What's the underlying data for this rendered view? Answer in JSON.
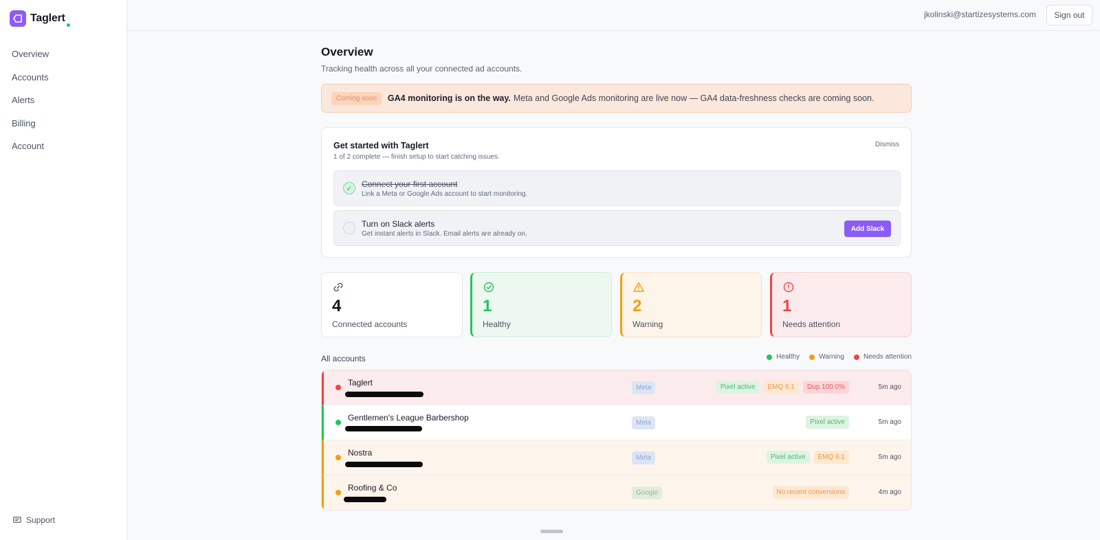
{
  "app": {
    "name": "Taglert"
  },
  "sidebar": {
    "items": [
      {
        "label": "Overview"
      },
      {
        "label": "Accounts"
      },
      {
        "label": "Alerts"
      },
      {
        "label": "Billing"
      },
      {
        "label": "Account"
      }
    ],
    "support_label": "Support"
  },
  "header": {
    "user_email": "jkolinski@startizesystems.com",
    "signout_label": "Sign out"
  },
  "page": {
    "title": "Overview",
    "subtitle": "Tracking health across all your connected ad accounts."
  },
  "banner": {
    "pill": "Coming soon",
    "strong": "GA4 monitoring is on the way.",
    "text": "Meta and Google Ads monitoring are live now — GA4 data-freshness checks are coming soon."
  },
  "setup": {
    "title": "Get started with Taglert",
    "subtitle": "1 of 2 complete — finish setup to start catching issues.",
    "dismiss_label": "Dismiss",
    "steps": [
      {
        "title": "Connect your first account",
        "desc": "Link a Meta or Google Ads account to start monitoring.",
        "done": true
      },
      {
        "title": "Turn on Slack alerts",
        "desc": "Get instant alerts in Slack. Email alerts are already on.",
        "done": false,
        "action": "Add Slack"
      }
    ]
  },
  "stats": [
    {
      "value": "4",
      "label": "Connected accounts",
      "icon": "link-icon",
      "color": "#131722"
    },
    {
      "value": "1",
      "label": "Healthy",
      "icon": "check-circle-icon",
      "color": "#22c55e"
    },
    {
      "value": "2",
      "label": "Warning",
      "icon": "warning-triangle-icon",
      "color": "#f59e0b"
    },
    {
      "value": "1",
      "label": "Needs attention",
      "icon": "alert-circle-icon",
      "color": "#ef4444"
    }
  ],
  "accounts": {
    "title": "All accounts",
    "legend": [
      "Healthy",
      "Warning",
      "Needs attention"
    ],
    "rows": [
      {
        "name": "Taglert",
        "status": "needs-attention",
        "platform": "Meta",
        "chips": [
          "Pixel active",
          "EMQ 6.1",
          "Dup 100.0%"
        ],
        "ago": "5m ago"
      },
      {
        "name": "Gentlemen's League Barbershop",
        "status": "healthy",
        "platform": "Meta",
        "chips": [
          "Pixel active"
        ],
        "ago": "5m ago"
      },
      {
        "name": "Nostra",
        "status": "warning",
        "platform": "Meta",
        "chips": [
          "Pixel active",
          "EMQ 6.1"
        ],
        "ago": "5m ago"
      },
      {
        "name": "Roofing & Co",
        "status": "warning",
        "platform": "Google",
        "chips": [
          "No recent conversions"
        ],
        "ago": "4m ago"
      }
    ]
  },
  "colors": {
    "accent": "#8b5cf6",
    "healthy": "#22c55e",
    "warning": "#f59e0b",
    "danger": "#ef4444"
  }
}
